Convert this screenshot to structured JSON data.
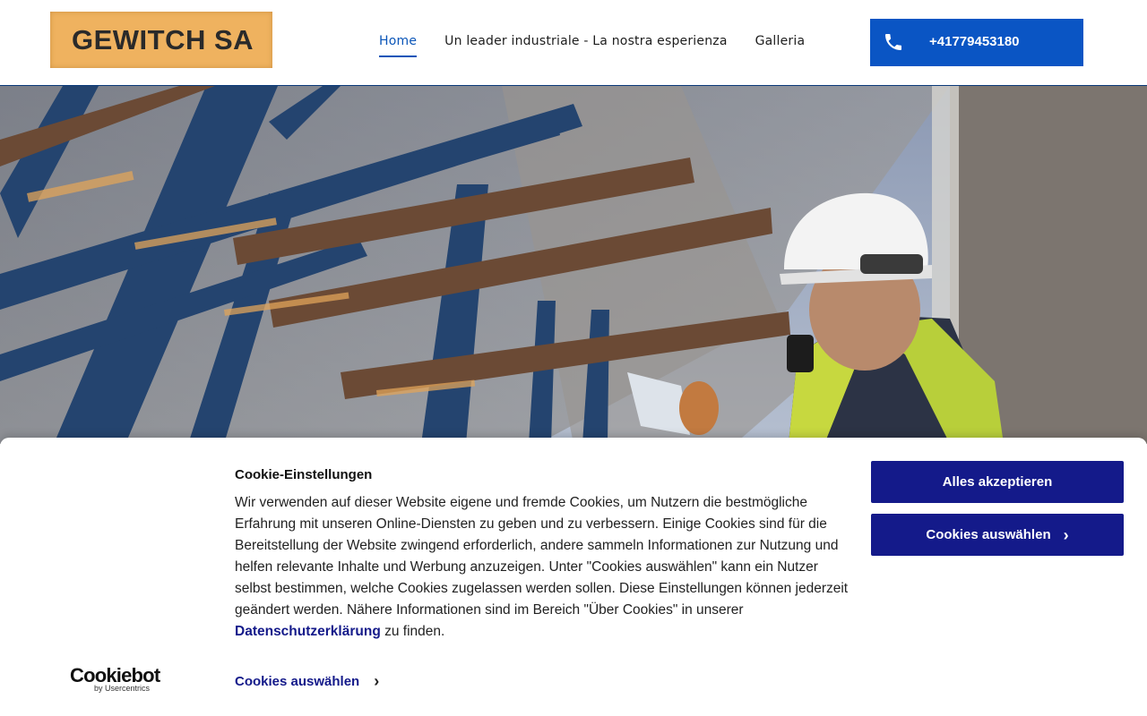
{
  "header": {
    "logo_text": "GEWITCH SA",
    "nav": [
      {
        "label": "Home",
        "active": true
      },
      {
        "label": "Un leader industriale - La nostra esperienza",
        "active": false
      },
      {
        "label": "Galleria",
        "active": false
      }
    ],
    "phone": "+41779453180"
  },
  "hero": {
    "image": "construction-worker-steel-structure-photo"
  },
  "cookie_banner": {
    "title": "Cookie-Einstellungen",
    "body_text": "Wir verwenden auf dieser Website eigene und fremde Cookies, um Nutzern die bestmögliche Erfahrung mit unseren Online-Diensten zu geben und zu verbessern. Einige Cookies sind für die Bereitstellung der Website zwingend erforderlich, andere sammeln Informationen zur Nutzung und helfen relevante Inhalte und Werbung anzuzeigen. Unter \"Cookies auswählen\" kann ein Nutzer selbst bestimmen, welche Cookies zugelassen werden sollen. Diese Einstellungen können jederzeit geändert werden. Nähere Informationen sind im Bereich \"Über Cookies\" in unserer",
    "privacy_link": "Datenschutzerklärung",
    "body_suffix": " zu finden.",
    "accept_all": "Alles akzeptieren",
    "select_cookies": "Cookies auswählen",
    "select_cookies_link": "Cookies auswählen",
    "brand": "Cookiebot",
    "brand_sub": "by Usercentrics"
  },
  "colors": {
    "brand_blue": "#0a55c4",
    "cookie_navy": "#141a8a",
    "logo_orange": "#efb25f"
  }
}
